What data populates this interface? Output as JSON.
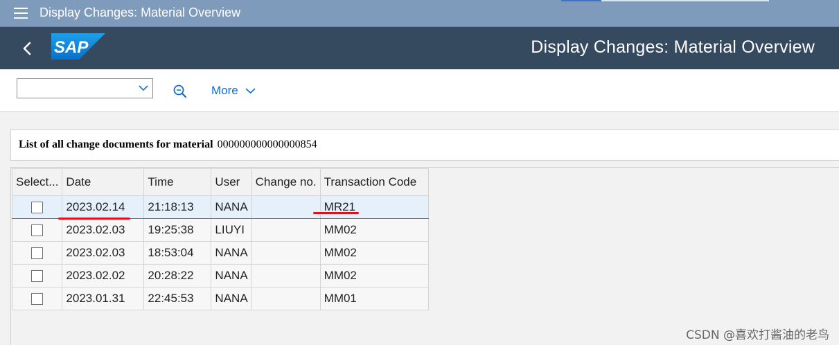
{
  "window": {
    "title": "Display Changes: Material Overview"
  },
  "shell": {
    "app_title": "Display Changes: Material Overview",
    "logo_text": "SAP"
  },
  "toolbar": {
    "variant_value": "",
    "more_label": "More"
  },
  "header": {
    "label": "List of all change documents for material",
    "material_number": "000000000000000854"
  },
  "table": {
    "columns": [
      "Select...",
      "Date",
      "Time",
      "User",
      "Change no.",
      "Transaction Code"
    ],
    "rows": [
      {
        "date": "2023.02.14",
        "time": "21:18:13",
        "user": "NANA",
        "change_no": "",
        "tcode": "MR21",
        "selected": true
      },
      {
        "date": "2023.02.03",
        "time": "19:25:38",
        "user": "LIUYI",
        "change_no": "",
        "tcode": "MM02",
        "selected": false
      },
      {
        "date": "2023.02.03",
        "time": "18:53:04",
        "user": "NANA",
        "change_no": "",
        "tcode": "MM02",
        "selected": false
      },
      {
        "date": "2023.02.02",
        "time": "20:28:22",
        "user": "NANA",
        "change_no": "",
        "tcode": "MM02",
        "selected": false
      },
      {
        "date": "2023.01.31",
        "time": "22:45:53",
        "user": "NANA",
        "change_no": "",
        "tcode": "MM01",
        "selected": false
      }
    ]
  },
  "watermark": "CSDN @喜欢打酱油的老鸟",
  "colors": {
    "shell_bg": "#354a5f",
    "window_bar": "#7f9bbb",
    "link": "#0a6ed1",
    "annotation_red": "#e0111b"
  },
  "icons": {
    "menu": "hamburger-icon",
    "back": "back-arrow-icon",
    "find": "search-icon",
    "dropdown": "chevron-down-icon"
  }
}
